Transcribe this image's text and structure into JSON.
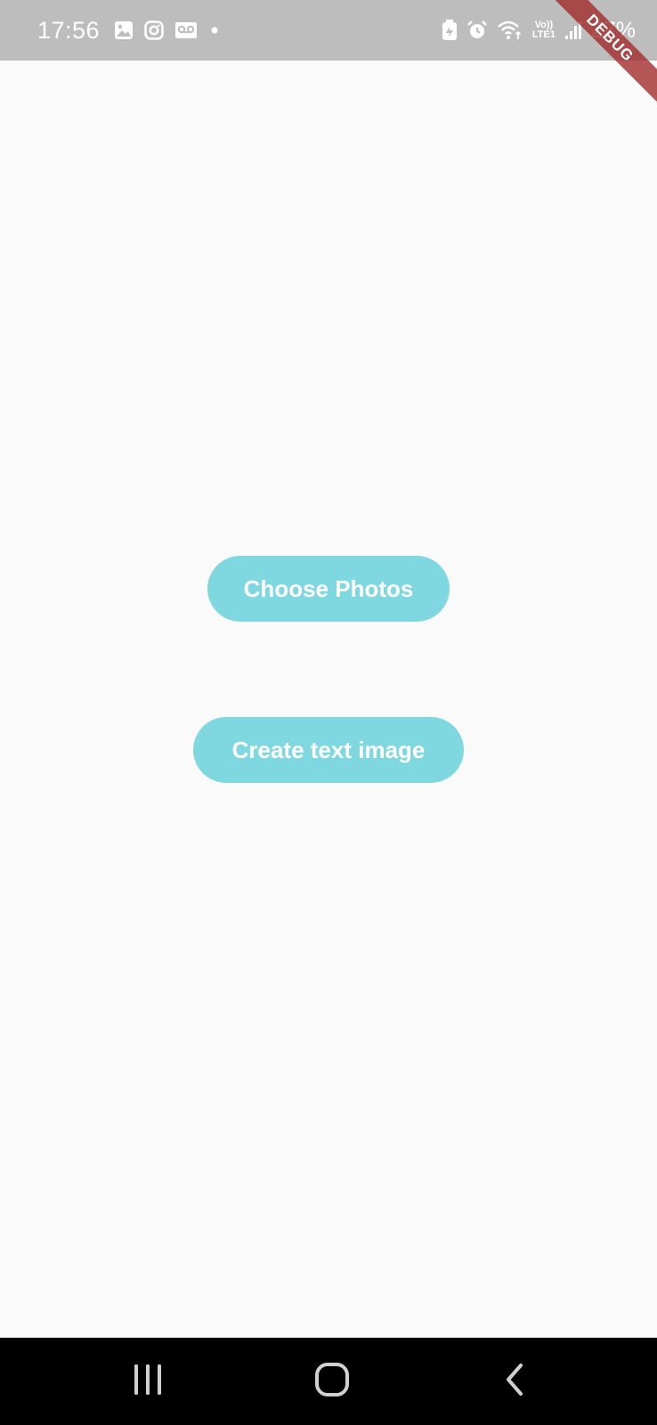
{
  "status_bar": {
    "time": "17:56",
    "notification_icons": [
      "gallery-icon",
      "instagram-icon",
      "voicemail-icon",
      "more-dot-icon"
    ],
    "system_icons": [
      "battery-saver-icon",
      "alarm-icon",
      "wifi-icon",
      "volte-icon",
      "signal-icon"
    ],
    "volte_top": "Vo))",
    "volte_bottom": "LTE1",
    "battery": "27%",
    "background": "#bdbdbd"
  },
  "debug_banner": {
    "label": "DEBUG",
    "color": "#a02828"
  },
  "main": {
    "buttons": [
      {
        "label": "Choose Photos"
      },
      {
        "label": "Create text image"
      }
    ],
    "button_color": "#7fd7e0",
    "background": "#fafafa"
  },
  "nav_bar": {
    "buttons": [
      "recent-apps-icon",
      "home-icon",
      "back-icon"
    ],
    "background": "#000000"
  }
}
